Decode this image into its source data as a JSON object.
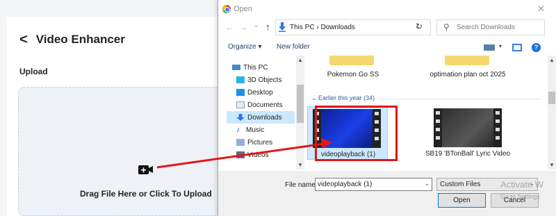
{
  "app": {
    "back_icon": "chevron-left-icon",
    "title": "Video Enhancer",
    "upload_label": "Upload",
    "upload_icon": "video-plus-icon",
    "drop_text": "Drag File Here or Click To Upload"
  },
  "dialog": {
    "title": "Open",
    "close": "✕",
    "nav": {
      "back": "←",
      "forward": "→",
      "recent": "⌄",
      "up": "↑"
    },
    "address": {
      "path_text": "This PC  ›  Downloads",
      "prefix": "›"
    },
    "refresh": "↻",
    "search_placeholder": "Search Downloads",
    "organize": "Organize ▾",
    "new_folder": "New folder",
    "help": "?",
    "nav_pane": [
      {
        "label": "This PC",
        "icon": "computer-icon"
      },
      {
        "label": "3D Objects",
        "icon": "cube-icon"
      },
      {
        "label": "Desktop",
        "icon": "desktop-icon"
      },
      {
        "label": "Documents",
        "icon": "documents-icon"
      },
      {
        "label": "Downloads",
        "icon": "download-icon",
        "selected": true
      },
      {
        "label": "Music",
        "icon": "music-icon"
      },
      {
        "label": "Pictures",
        "icon": "pictures-icon"
      },
      {
        "label": "Videos",
        "icon": "videos-icon"
      }
    ],
    "top_folders": [
      {
        "name": "Pokemon Go SS"
      },
      {
        "name": "optimation plan oct 2025"
      }
    ],
    "group_header": "Earlier this year (34)",
    "files": [
      {
        "name": "videoplayback (1)",
        "selected": true
      },
      {
        "name": "SB19 'BTonBall' Lyric Video",
        "selected": false
      }
    ],
    "file_name_label": "File name:",
    "file_name_value": "videoplayback (1)",
    "file_type": "Custom Files",
    "open_button": "Open",
    "cancel_button": "Cancel",
    "watermark": "Activate W",
    "watermark_sub": "Go to Settings"
  },
  "colors": {
    "annotation": "#e01616",
    "selection": "#cce8ff",
    "link": "#1f3f6e"
  }
}
